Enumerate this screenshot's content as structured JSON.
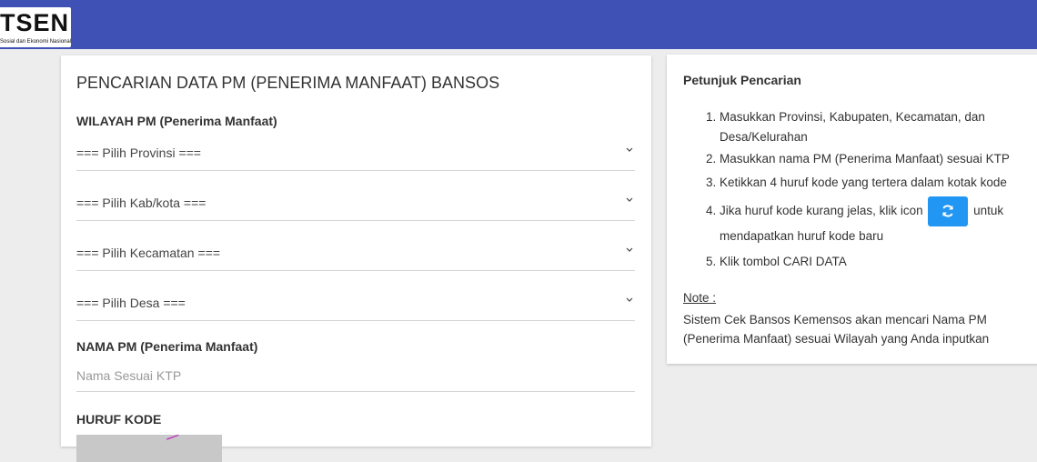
{
  "header": {
    "logo_main": "TSEN",
    "logo_sub": "Sosial dan Ekonomi Nasional",
    "bg_color": "#3f51b5"
  },
  "form": {
    "title": "PENCARIAN DATA PM (PENERIMA MANFAAT) BANSOS",
    "wilayah_label": "WILAYAH PM (Penerima Manfaat)",
    "provinsi_select": "=== Pilih Provinsi ===",
    "kabkota_select": "=== Pilih Kab/kota ===",
    "kecamatan_select": "=== Pilih Kecamatan ===",
    "desa_select": "=== Pilih Desa ===",
    "nama_label": "NAMA PM (Penerima Manfaat)",
    "nama_placeholder": "Nama Sesuai KTP",
    "kode_label": "HURUF KODE"
  },
  "guide": {
    "title": "Petunjuk Pencarian",
    "steps": [
      {
        "num": "1.",
        "text": "Masukkan Provinsi, Kabupaten, Kecamatan, dan Desa/Kelurahan"
      },
      {
        "num": "2.",
        "text": "Masukkan nama PM (Penerima Manfaat) sesuai KTP"
      },
      {
        "num": "3.",
        "text": "Ketikkan 4 huruf kode yang tertera dalam kotak kode"
      },
      {
        "num": "4.",
        "text_before": "Jika huruf kode kurang jelas, klik icon",
        "text_after": "untuk",
        "text_line2": "mendapatkan huruf kode baru"
      },
      {
        "num": "5.",
        "text": "Klik tombol CARI DATA"
      }
    ],
    "refresh_icon": "refresh-icon",
    "refresh_color": "#2196f3",
    "note_label": "Note :",
    "note_text": "Sistem Cek Bansos Kemensos akan mencari Nama PM (Penerima Manfaat) sesuai Wilayah yang Anda inputkan"
  }
}
